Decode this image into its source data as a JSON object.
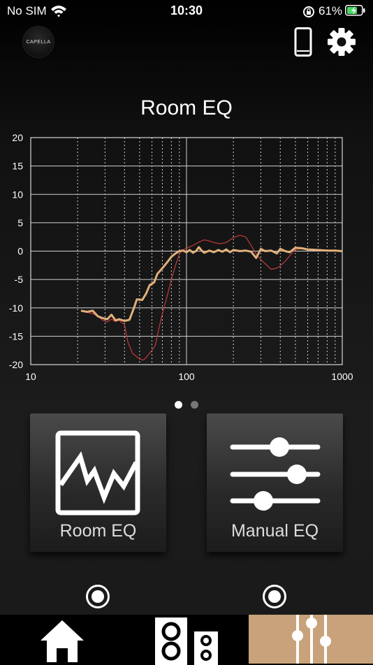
{
  "status_bar": {
    "carrier": "No SIM",
    "time": "10:30",
    "battery_percent": "61%"
  },
  "header": {
    "logo_text": "CAPELLA",
    "icons": [
      "phone-icon",
      "gear-icon"
    ]
  },
  "chart_data": {
    "type": "line",
    "title": "Room EQ",
    "xlabel": "",
    "ylabel": "",
    "x_scale": "log",
    "xlim": [
      10,
      1000
    ],
    "ylim": [
      -20,
      20
    ],
    "x_ticks": [
      "10",
      "100",
      "1000"
    ],
    "y_ticks": [
      "20",
      "15",
      "10",
      "5",
      "0",
      "-5",
      "-10",
      "-15",
      "-20"
    ],
    "grid": true,
    "series": [
      {
        "color": "#c23a3a",
        "points": [
          [
            21,
            -10.6
          ],
          [
            23,
            -10.8
          ],
          [
            25,
            -11
          ],
          [
            27,
            -11.5
          ],
          [
            29,
            -12.2
          ],
          [
            31,
            -12.5
          ],
          [
            33,
            -12
          ],
          [
            35,
            -12.4
          ],
          [
            37,
            -12.2
          ],
          [
            40,
            -13
          ],
          [
            42,
            -16
          ],
          [
            45,
            -18
          ],
          [
            48,
            -18.6
          ],
          [
            50,
            -19
          ],
          [
            53,
            -19.2
          ],
          [
            56,
            -18.5
          ],
          [
            60,
            -17.5
          ],
          [
            63,
            -16.6
          ],
          [
            66,
            -14
          ],
          [
            70,
            -11
          ],
          [
            75,
            -8
          ],
          [
            80,
            -5
          ],
          [
            85,
            -2.5
          ],
          [
            90,
            -0.5
          ],
          [
            95,
            0.2
          ],
          [
            100,
            0.5
          ],
          [
            110,
            1
          ],
          [
            120,
            1.6
          ],
          [
            130,
            2
          ],
          [
            140,
            1.8
          ],
          [
            150,
            1.5
          ],
          [
            165,
            1.3
          ],
          [
            180,
            1.5
          ],
          [
            200,
            2.4
          ],
          [
            220,
            2.8
          ],
          [
            240,
            2.5
          ],
          [
            260,
            1
          ],
          [
            280,
            -0.5
          ],
          [
            300,
            -1.5
          ],
          [
            320,
            -2.2
          ],
          [
            350,
            -3.2
          ],
          [
            380,
            -3
          ],
          [
            400,
            -2.6
          ],
          [
            430,
            -1.8
          ],
          [
            460,
            -0.8
          ],
          [
            500,
            0.3
          ],
          [
            550,
            0.4
          ],
          [
            600,
            0.2
          ],
          [
            700,
            0.1
          ],
          [
            800,
            0
          ],
          [
            900,
            0
          ],
          [
            1000,
            0
          ]
        ]
      },
      {
        "color": "#e0b07a",
        "points": [
          [
            21,
            -10.5
          ],
          [
            23,
            -10.7
          ],
          [
            25,
            -10.5
          ],
          [
            27,
            -11.5
          ],
          [
            29,
            -11.8
          ],
          [
            31,
            -12
          ],
          [
            33,
            -11.2
          ],
          [
            35,
            -12.2
          ],
          [
            37,
            -12
          ],
          [
            40,
            -12.3
          ],
          [
            43,
            -12.1
          ],
          [
            46,
            -10
          ],
          [
            48,
            -8.5
          ],
          [
            52,
            -8.6
          ],
          [
            55,
            -7.5
          ],
          [
            58,
            -6
          ],
          [
            62,
            -5.5
          ],
          [
            65,
            -4
          ],
          [
            70,
            -3
          ],
          [
            75,
            -2
          ],
          [
            80,
            -1
          ],
          [
            85,
            -0.4
          ],
          [
            90,
            0
          ],
          [
            95,
            0.1
          ],
          [
            100,
            -0.2
          ],
          [
            105,
            0.2
          ],
          [
            110,
            -0.3
          ],
          [
            115,
            0
          ],
          [
            120,
            0.7
          ],
          [
            125,
            0.1
          ],
          [
            130,
            -0.3
          ],
          [
            140,
            0.1
          ],
          [
            150,
            -0.2
          ],
          [
            160,
            0.2
          ],
          [
            170,
            -0.1
          ],
          [
            180,
            0.3
          ],
          [
            190,
            -0.2
          ],
          [
            200,
            0.2
          ],
          [
            220,
            0
          ],
          [
            240,
            0.1
          ],
          [
            260,
            -0.1
          ],
          [
            280,
            -1.2
          ],
          [
            300,
            0.4
          ],
          [
            320,
            0
          ],
          [
            350,
            0.1
          ],
          [
            380,
            -0.4
          ],
          [
            400,
            0.4
          ],
          [
            430,
            0
          ],
          [
            460,
            -0.2
          ],
          [
            500,
            0.6
          ],
          [
            550,
            0.5
          ],
          [
            600,
            0.3
          ],
          [
            700,
            0.2
          ],
          [
            800,
            0.1
          ],
          [
            900,
            0.1
          ],
          [
            1000,
            0
          ]
        ]
      }
    ]
  },
  "page_indicator": {
    "count": 2,
    "active": 0
  },
  "tiles": [
    {
      "label": "Room EQ"
    },
    {
      "label": "Manual EQ"
    }
  ],
  "colors": {
    "accent": "#c8a27a",
    "series_measured": "#c23a3a",
    "series_corrected": "#e0b07a"
  },
  "tab_bar": {
    "tabs": [
      "home-icon",
      "speakers-icon",
      "eq-sliders-icon"
    ],
    "active": 2
  }
}
